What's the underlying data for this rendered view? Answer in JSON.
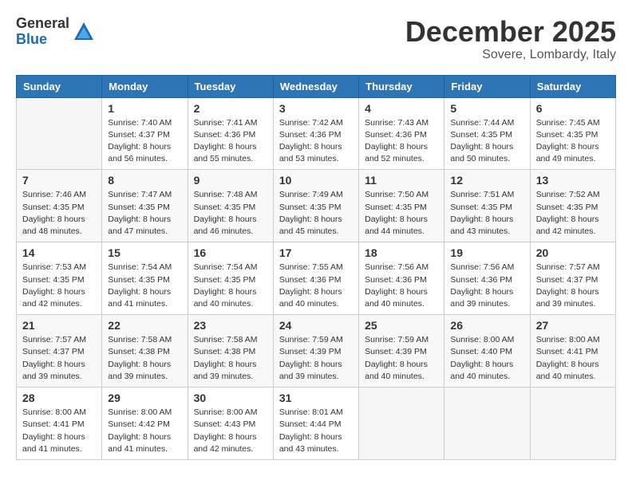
{
  "logo": {
    "general": "General",
    "blue": "Blue"
  },
  "header": {
    "month": "December 2025",
    "location": "Sovere, Lombardy, Italy"
  },
  "weekdays": [
    "Sunday",
    "Monday",
    "Tuesday",
    "Wednesday",
    "Thursday",
    "Friday",
    "Saturday"
  ],
  "weeks": [
    [
      {
        "day": "",
        "sunrise": "",
        "sunset": "",
        "daylight": ""
      },
      {
        "day": "1",
        "sunrise": "Sunrise: 7:40 AM",
        "sunset": "Sunset: 4:37 PM",
        "daylight": "Daylight: 8 hours and 56 minutes."
      },
      {
        "day": "2",
        "sunrise": "Sunrise: 7:41 AM",
        "sunset": "Sunset: 4:36 PM",
        "daylight": "Daylight: 8 hours and 55 minutes."
      },
      {
        "day": "3",
        "sunrise": "Sunrise: 7:42 AM",
        "sunset": "Sunset: 4:36 PM",
        "daylight": "Daylight: 8 hours and 53 minutes."
      },
      {
        "day": "4",
        "sunrise": "Sunrise: 7:43 AM",
        "sunset": "Sunset: 4:36 PM",
        "daylight": "Daylight: 8 hours and 52 minutes."
      },
      {
        "day": "5",
        "sunrise": "Sunrise: 7:44 AM",
        "sunset": "Sunset: 4:35 PM",
        "daylight": "Daylight: 8 hours and 50 minutes."
      },
      {
        "day": "6",
        "sunrise": "Sunrise: 7:45 AM",
        "sunset": "Sunset: 4:35 PM",
        "daylight": "Daylight: 8 hours and 49 minutes."
      }
    ],
    [
      {
        "day": "7",
        "sunrise": "Sunrise: 7:46 AM",
        "sunset": "Sunset: 4:35 PM",
        "daylight": "Daylight: 8 hours and 48 minutes."
      },
      {
        "day": "8",
        "sunrise": "Sunrise: 7:47 AM",
        "sunset": "Sunset: 4:35 PM",
        "daylight": "Daylight: 8 hours and 47 minutes."
      },
      {
        "day": "9",
        "sunrise": "Sunrise: 7:48 AM",
        "sunset": "Sunset: 4:35 PM",
        "daylight": "Daylight: 8 hours and 46 minutes."
      },
      {
        "day": "10",
        "sunrise": "Sunrise: 7:49 AM",
        "sunset": "Sunset: 4:35 PM",
        "daylight": "Daylight: 8 hours and 45 minutes."
      },
      {
        "day": "11",
        "sunrise": "Sunrise: 7:50 AM",
        "sunset": "Sunset: 4:35 PM",
        "daylight": "Daylight: 8 hours and 44 minutes."
      },
      {
        "day": "12",
        "sunrise": "Sunrise: 7:51 AM",
        "sunset": "Sunset: 4:35 PM",
        "daylight": "Daylight: 8 hours and 43 minutes."
      },
      {
        "day": "13",
        "sunrise": "Sunrise: 7:52 AM",
        "sunset": "Sunset: 4:35 PM",
        "daylight": "Daylight: 8 hours and 42 minutes."
      }
    ],
    [
      {
        "day": "14",
        "sunrise": "Sunrise: 7:53 AM",
        "sunset": "Sunset: 4:35 PM",
        "daylight": "Daylight: 8 hours and 42 minutes."
      },
      {
        "day": "15",
        "sunrise": "Sunrise: 7:54 AM",
        "sunset": "Sunset: 4:35 PM",
        "daylight": "Daylight: 8 hours and 41 minutes."
      },
      {
        "day": "16",
        "sunrise": "Sunrise: 7:54 AM",
        "sunset": "Sunset: 4:35 PM",
        "daylight": "Daylight: 8 hours and 40 minutes."
      },
      {
        "day": "17",
        "sunrise": "Sunrise: 7:55 AM",
        "sunset": "Sunset: 4:36 PM",
        "daylight": "Daylight: 8 hours and 40 minutes."
      },
      {
        "day": "18",
        "sunrise": "Sunrise: 7:56 AM",
        "sunset": "Sunset: 4:36 PM",
        "daylight": "Daylight: 8 hours and 40 minutes."
      },
      {
        "day": "19",
        "sunrise": "Sunrise: 7:56 AM",
        "sunset": "Sunset: 4:36 PM",
        "daylight": "Daylight: 8 hours and 39 minutes."
      },
      {
        "day": "20",
        "sunrise": "Sunrise: 7:57 AM",
        "sunset": "Sunset: 4:37 PM",
        "daylight": "Daylight: 8 hours and 39 minutes."
      }
    ],
    [
      {
        "day": "21",
        "sunrise": "Sunrise: 7:57 AM",
        "sunset": "Sunset: 4:37 PM",
        "daylight": "Daylight: 8 hours and 39 minutes."
      },
      {
        "day": "22",
        "sunrise": "Sunrise: 7:58 AM",
        "sunset": "Sunset: 4:38 PM",
        "daylight": "Daylight: 8 hours and 39 minutes."
      },
      {
        "day": "23",
        "sunrise": "Sunrise: 7:58 AM",
        "sunset": "Sunset: 4:38 PM",
        "daylight": "Daylight: 8 hours and 39 minutes."
      },
      {
        "day": "24",
        "sunrise": "Sunrise: 7:59 AM",
        "sunset": "Sunset: 4:39 PM",
        "daylight": "Daylight: 8 hours and 39 minutes."
      },
      {
        "day": "25",
        "sunrise": "Sunrise: 7:59 AM",
        "sunset": "Sunset: 4:39 PM",
        "daylight": "Daylight: 8 hours and 40 minutes."
      },
      {
        "day": "26",
        "sunrise": "Sunrise: 8:00 AM",
        "sunset": "Sunset: 4:40 PM",
        "daylight": "Daylight: 8 hours and 40 minutes."
      },
      {
        "day": "27",
        "sunrise": "Sunrise: 8:00 AM",
        "sunset": "Sunset: 4:41 PM",
        "daylight": "Daylight: 8 hours and 40 minutes."
      }
    ],
    [
      {
        "day": "28",
        "sunrise": "Sunrise: 8:00 AM",
        "sunset": "Sunset: 4:41 PM",
        "daylight": "Daylight: 8 hours and 41 minutes."
      },
      {
        "day": "29",
        "sunrise": "Sunrise: 8:00 AM",
        "sunset": "Sunset: 4:42 PM",
        "daylight": "Daylight: 8 hours and 41 minutes."
      },
      {
        "day": "30",
        "sunrise": "Sunrise: 8:00 AM",
        "sunset": "Sunset: 4:43 PM",
        "daylight": "Daylight: 8 hours and 42 minutes."
      },
      {
        "day": "31",
        "sunrise": "Sunrise: 8:01 AM",
        "sunset": "Sunset: 4:44 PM",
        "daylight": "Daylight: 8 hours and 43 minutes."
      },
      {
        "day": "",
        "sunrise": "",
        "sunset": "",
        "daylight": ""
      },
      {
        "day": "",
        "sunrise": "",
        "sunset": "",
        "daylight": ""
      },
      {
        "day": "",
        "sunrise": "",
        "sunset": "",
        "daylight": ""
      }
    ]
  ]
}
